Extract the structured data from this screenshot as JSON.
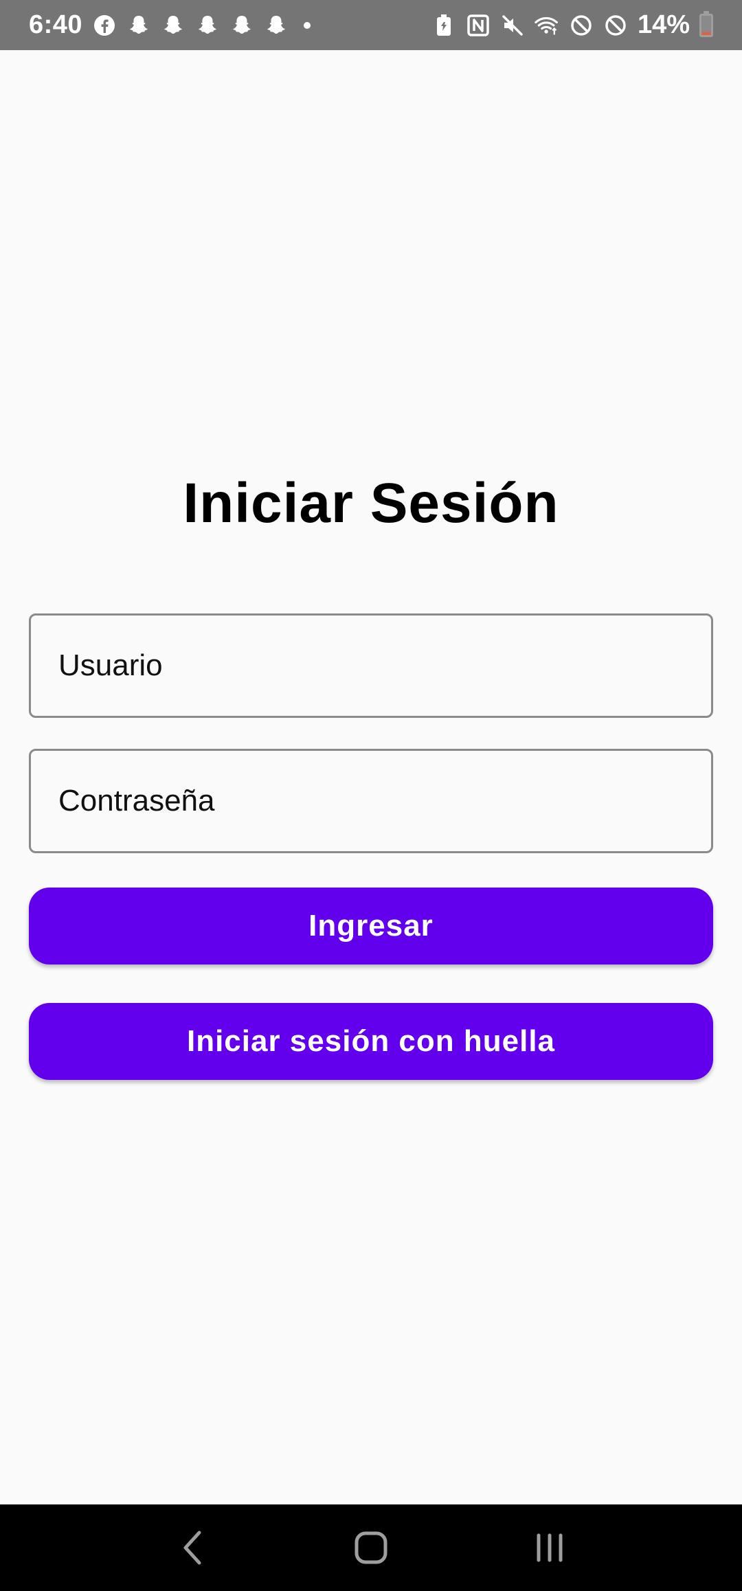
{
  "status_bar": {
    "time": "6:40",
    "battery_percent": "14%",
    "battery_level": 0.14,
    "notification_icons": [
      "facebook-icon",
      "snapchat-icon",
      "snapchat-icon",
      "snapchat-icon",
      "snapchat-icon",
      "snapchat-icon",
      "more-dot-icon"
    ],
    "system_icons": [
      "battery-saver-icon",
      "nfc-icon",
      "mute-icon",
      "wifi-icon",
      "do-not-disturb-icon",
      "blocked-icon",
      "battery-icon"
    ]
  },
  "login": {
    "title": "Iniciar Sesión",
    "username_placeholder": "Usuario",
    "password_placeholder": "Contraseña",
    "submit_label": "Ingresar",
    "fingerprint_label": "Iniciar sesión con huella"
  },
  "nav_bar": {
    "buttons": [
      "back-icon",
      "home-icon",
      "recents-icon"
    ]
  },
  "colors": {
    "accent": "#6200ee",
    "status_bar": "#757575",
    "background": "#fafafa"
  }
}
